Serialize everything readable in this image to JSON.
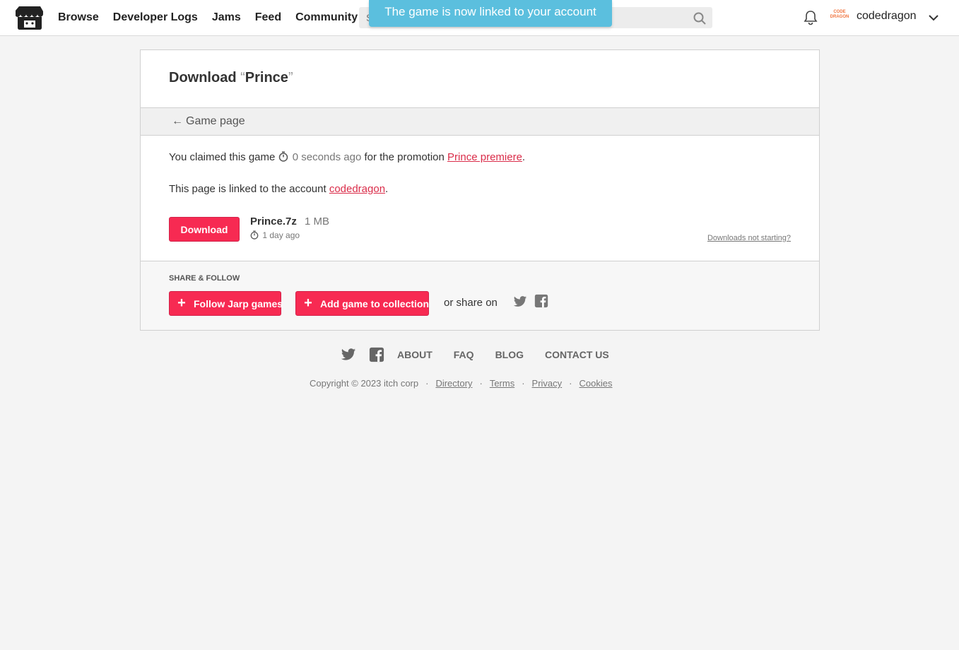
{
  "header": {
    "nav": [
      "Browse",
      "Developer Logs",
      "Jams",
      "Feed",
      "Community"
    ],
    "search_placeholder": "Search for games or creators",
    "username": "codedragon",
    "avatar_text": "CODE DRAGON"
  },
  "toast": "The game is now linked to your account",
  "card": {
    "title_prefix": "Download",
    "title_open_quote": "“",
    "game_name": "Prince",
    "title_close_quote": "”",
    "back_link": "Game page",
    "claim_prefix": "You claimed this game",
    "claim_time": "0 seconds ago",
    "claim_middle": "for the promotion",
    "promotion": "Prince premiere",
    "period": ".",
    "linked_prefix": "This page is linked to the account",
    "linked_account": "codedragon",
    "download_label": "Download",
    "file_name": "Prince.7z",
    "file_size": "1 MB",
    "file_date": "1 day ago",
    "not_starting": "Downloads not starting?"
  },
  "share": {
    "title": "SHARE & FOLLOW",
    "follow_label": "Follow Jarp games",
    "collection_label": "Add game to collection",
    "share_text": "or share on"
  },
  "footer": {
    "links": [
      "ABOUT",
      "FAQ",
      "BLOG",
      "CONTACT US"
    ],
    "copyright": "Copyright © 2023 itch corp",
    "legal": [
      "Directory",
      "Terms",
      "Privacy",
      "Cookies"
    ]
  },
  "colors": {
    "accent": "#f72a52",
    "link": "#da2c49",
    "toast": "#5bbfde"
  }
}
